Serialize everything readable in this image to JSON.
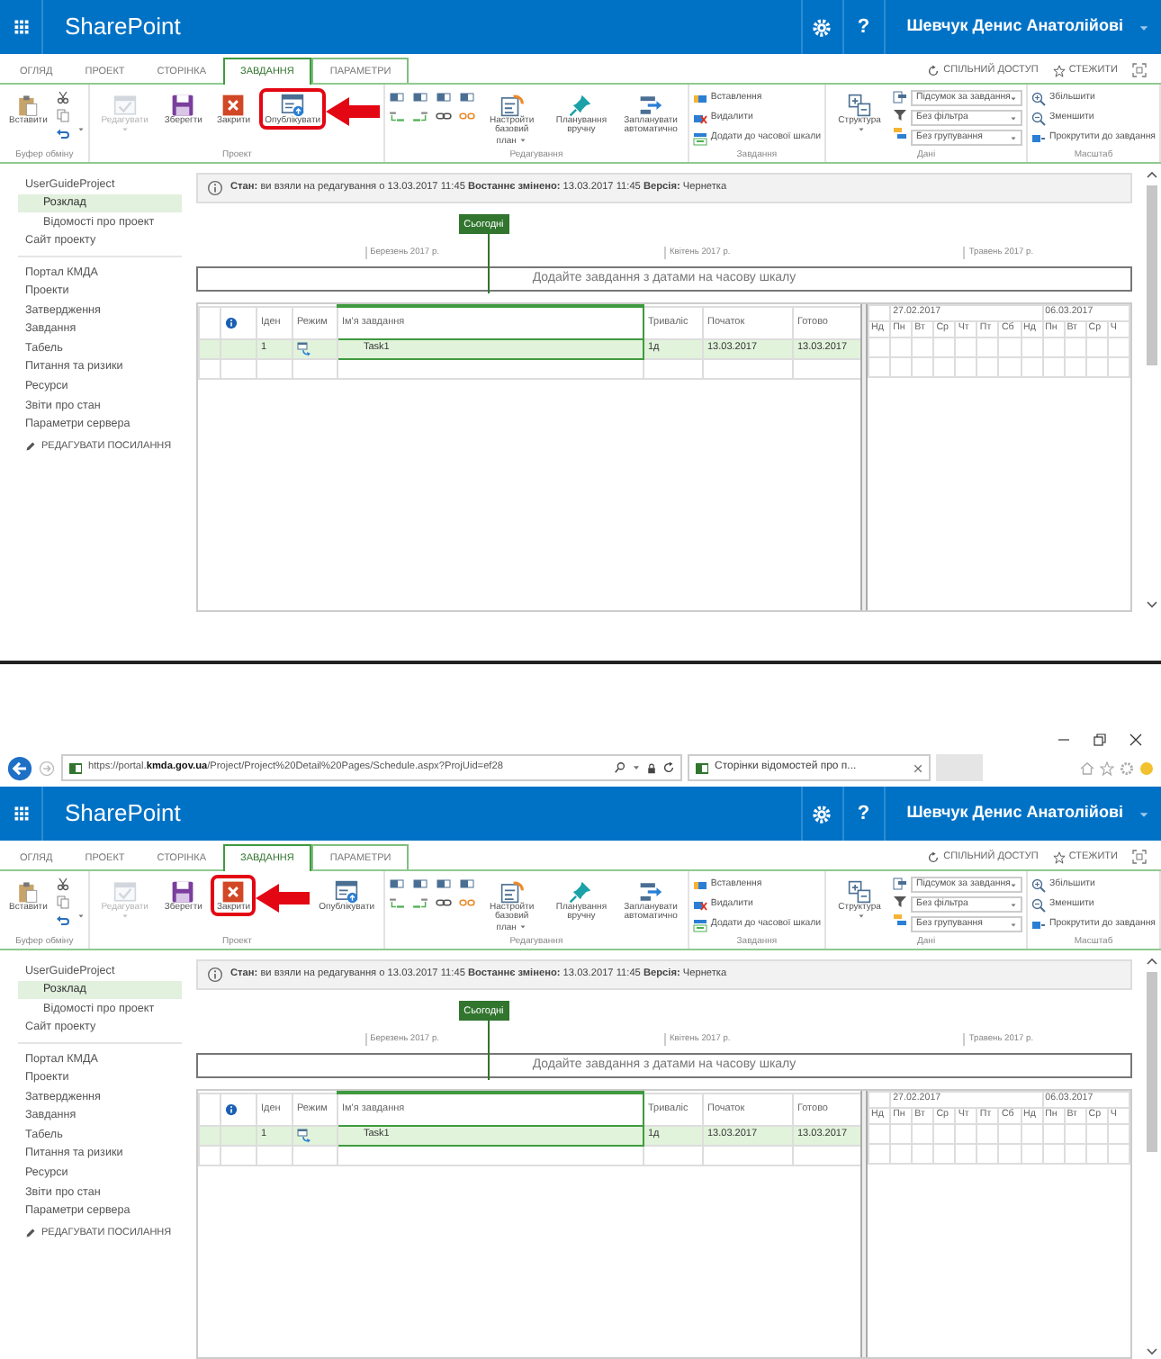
{
  "screens": [
    {
      "suite_bar": {
        "title": "SharePoint",
        "help": "?",
        "user": "Шевчук Денис Анатолійові"
      },
      "tabs": [
        {
          "label": "ОГЛЯД",
          "selected": false,
          "contextual": false
        },
        {
          "label": "ПРОЕКТ",
          "selected": false,
          "contextual": false
        },
        {
          "label": "СТОРІНКА",
          "selected": false,
          "contextual": false
        },
        {
          "label": "ЗАВДАННЯ",
          "selected": true,
          "contextual": true
        },
        {
          "label": "ПАРАМЕТРИ",
          "selected": false,
          "contextual": true
        }
      ],
      "header_actions": [
        {
          "label": "СПІЛЬНИЙ ДОСТУП"
        },
        {
          "label": "СТЕЖИТИ"
        }
      ],
      "ribbon": [
        {
          "kind": "clipboard",
          "label": "Буфер обміну",
          "buttons": [
            {
              "label": "Вставити"
            }
          ]
        },
        {
          "kind": "project",
          "label": "Проект",
          "buttons": [
            {
              "label": "Редагувати",
              "disabled": true,
              "dropdown": true,
              "highlighted": false
            },
            {
              "label": "Зберегти",
              "disabled": false,
              "dropdown": false,
              "highlighted": false
            },
            {
              "label": "Закрити",
              "disabled": false,
              "dropdown": false,
              "highlighted": false
            },
            {
              "label": "Опублікувати",
              "disabled": false,
              "dropdown": false,
              "highlighted": true
            }
          ]
        },
        {
          "kind": "editing",
          "label": "Редагування",
          "buttons": [
            {
              "label": "Настройти базовий план",
              "dropdown": true
            },
            {
              "label": "Планування вручну",
              "dropdown": false
            },
            {
              "label": "Запланувати автоматично",
              "dropdown": false
            }
          ]
        },
        {
          "kind": "tasks",
          "label": "Завдання",
          "buttons": [
            {
              "label": "Вставлення"
            },
            {
              "label": "Видалити"
            },
            {
              "label": "Додати до часової шкали"
            }
          ]
        },
        {
          "kind": "data",
          "label": "Дані",
          "buttons": [
            {
              "label": "Структура",
              "dropdown": true
            }
          ],
          "dropdowns": [
            {
              "value": "Підсумок за завдання"
            },
            {
              "value": "Без фільтра"
            },
            {
              "value": "Без групування"
            }
          ]
        },
        {
          "kind": "zoom",
          "label": "Масштаб",
          "buttons": [
            {
              "label": "Збільшити"
            },
            {
              "label": "Зменшити"
            },
            {
              "label": "Прокрутити до завдання"
            }
          ]
        }
      ],
      "sidebar": {
        "sections": [
          {
            "items": [
              {
                "label": "UserGuideProject",
                "selected": false,
                "children": [
                  {
                    "label": "Розклад",
                    "selected": true
                  },
                  {
                    "label": "Відомості про проект",
                    "selected": false
                  }
                ]
              },
              {
                "label": "Сайт проекту",
                "selected": false
              }
            ]
          },
          {
            "items": [
              {
                "label": "Портал КМДА",
                "selected": false
              },
              {
                "label": "Проекти",
                "selected": false
              },
              {
                "label": "Затвердження",
                "selected": false
              },
              {
                "label": "Завдання",
                "selected": false
              },
              {
                "label": "Табель",
                "selected": false
              },
              {
                "label": "Питання та ризики",
                "selected": false
              },
              {
                "label": "Ресурси",
                "selected": false
              },
              {
                "label": "Звіти про стан",
                "selected": false
              },
              {
                "label": "Параметри сервера",
                "selected": false
              }
            ]
          }
        ],
        "edit_link": "РЕДАГУВАТИ ПОСИЛАННЯ"
      },
      "status": "**Стан:** ви взяли на редагування о 13.03.2017 11:45 **Востаннє змінено:** 13.03.2017 11:45 **Версія:** Чернетка",
      "timeline": {
        "today": "Сьогодні",
        "months": [
          "Березень 2017 р.",
          "Квітень 2017 р.",
          "Травень 2017 р."
        ],
        "placeholder": "Додайте завдання з датами на часову шкалу"
      },
      "grid": {
        "columns": [
          "Іден",
          "Режим",
          "Ім'я завдання",
          "Триваліс",
          "Початок",
          "Готово"
        ],
        "rows": [
          {
            "id": "1",
            "name": "Task1",
            "duration": "1д",
            "start": "13.03.2017",
            "finish": "13.03.2017",
            "selected": true
          }
        ],
        "weeks": [
          "27.02.2017",
          "06.03.2017"
        ],
        "days": [
          "Нд",
          "Пн",
          "Вт",
          "Ср",
          "Чт",
          "Пт",
          "Сб",
          "Нд",
          "Пн",
          "Вт",
          "Ср",
          "Ч"
        ]
      }
    },
    {
      "browser": {
        "url": "https://portal.**kmda.gov.ua**/Project/Project%20Detail%20Pages/Schedule.aspx?ProjUid=ef28",
        "tab_title": "Сторінки відомостей про п..."
      },
      "suite_bar": {
        "title": "SharePoint",
        "help": "?",
        "user": "Шевчук Денис Анатолійові"
      },
      "tabs": [
        {
          "label": "ОГЛЯД",
          "selected": false,
          "contextual": false
        },
        {
          "label": "ПРОЕКТ",
          "selected": false,
          "contextual": false
        },
        {
          "label": "СТОРІНКА",
          "selected": false,
          "contextual": false
        },
        {
          "label": "ЗАВДАННЯ",
          "selected": true,
          "contextual": true
        },
        {
          "label": "ПАРАМЕТРИ",
          "selected": false,
          "contextual": true
        }
      ],
      "header_actions": [
        {
          "label": "СПІЛЬНИЙ ДОСТУП"
        },
        {
          "label": "СТЕЖИТИ"
        }
      ],
      "ribbon": [
        {
          "kind": "clipboard",
          "label": "Буфер обміну",
          "buttons": [
            {
              "label": "Вставити"
            }
          ]
        },
        {
          "kind": "project",
          "label": "Проект",
          "buttons": [
            {
              "label": "Редагувати",
              "disabled": true,
              "dropdown": true,
              "highlighted": false
            },
            {
              "label": "Зберегти",
              "disabled": false,
              "dropdown": false,
              "highlighted": false
            },
            {
              "label": "Закрити",
              "disabled": false,
              "dropdown": false,
              "highlighted": true
            },
            {
              "label": "Опублікувати",
              "disabled": false,
              "dropdown": false,
              "highlighted": false
            }
          ]
        },
        {
          "kind": "editing",
          "label": "Редагування",
          "buttons": [
            {
              "label": "Настройти базовий план",
              "dropdown": true
            },
            {
              "label": "Планування вручну",
              "dropdown": false
            },
            {
              "label": "Запланувати автоматично",
              "dropdown": false
            }
          ]
        },
        {
          "kind": "tasks",
          "label": "Завдання",
          "buttons": [
            {
              "label": "Вставлення"
            },
            {
              "label": "Видалити"
            },
            {
              "label": "Додати до часової шкали"
            }
          ]
        },
        {
          "kind": "data",
          "label": "Дані",
          "buttons": [
            {
              "label": "Структура",
              "dropdown": true
            }
          ],
          "dropdowns": [
            {
              "value": "Підсумок за завдання"
            },
            {
              "value": "Без фільтра"
            },
            {
              "value": "Без групування"
            }
          ]
        },
        {
          "kind": "zoom",
          "label": "Масштаб",
          "buttons": [
            {
              "label": "Збільшити"
            },
            {
              "label": "Зменшити"
            },
            {
              "label": "Прокрутити до завдання"
            }
          ]
        }
      ],
      "sidebar": {
        "sections": [
          {
            "items": [
              {
                "label": "UserGuideProject",
                "selected": false,
                "children": [
                  {
                    "label": "Розклад",
                    "selected": true
                  },
                  {
                    "label": "Відомості про проект",
                    "selected": false
                  }
                ]
              },
              {
                "label": "Сайт проекту",
                "selected": false
              }
            ]
          },
          {
            "items": [
              {
                "label": "Портал КМДА",
                "selected": false
              },
              {
                "label": "Проекти",
                "selected": false
              },
              {
                "label": "Затвердження",
                "selected": false
              },
              {
                "label": "Завдання",
                "selected": false
              },
              {
                "label": "Табель",
                "selected": false
              },
              {
                "label": "Питання та ризики",
                "selected": false
              },
              {
                "label": "Ресурси",
                "selected": false
              },
              {
                "label": "Звіти про стан",
                "selected": false
              },
              {
                "label": "Параметри сервера",
                "selected": false
              }
            ]
          }
        ],
        "edit_link": "РЕДАГУВАТИ ПОСИЛАННЯ"
      },
      "status": "**Стан:** ви взяли на редагування о 13.03.2017 11:45 **Востаннє змінено:** 13.03.2017 11:45 **Версія:** Чернетка",
      "timeline": {
        "today": "Сьогодні",
        "months": [
          "Березень 2017 р.",
          "Квітень 2017 р.",
          "Травень 2017 р."
        ],
        "placeholder": "Додайте завдання з датами на часову шкалу"
      },
      "grid": {
        "columns": [
          "Іден",
          "Режим",
          "Ім'я завдання",
          "Триваліс",
          "Початок",
          "Готово"
        ],
        "rows": [
          {
            "id": "1",
            "name": "Task1",
            "duration": "1д",
            "start": "13.03.2017",
            "finish": "13.03.2017",
            "selected": true
          }
        ],
        "weeks": [
          "27.02.2017",
          "06.03.2017"
        ],
        "days": [
          "Нд",
          "Пн",
          "Вт",
          "Ср",
          "Чт",
          "Пт",
          "Сб",
          "Нд",
          "Пн",
          "Вт",
          "Ср",
          "Ч"
        ]
      }
    }
  ]
}
